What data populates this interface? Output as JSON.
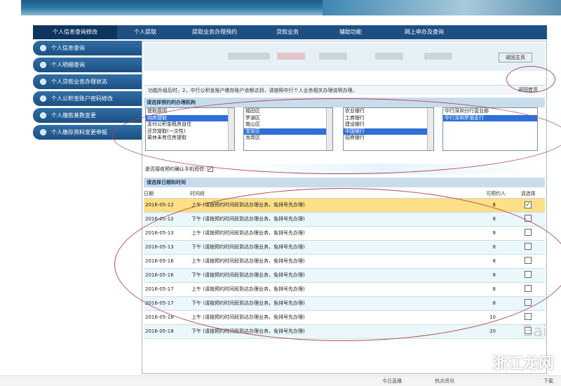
{
  "nav": {
    "tabs": [
      "个人信息查询修改",
      "个人提取",
      "提取业务办理预约",
      "贷款业务",
      "辅助功能",
      "网上申办及查询"
    ]
  },
  "sidebar": {
    "items": [
      "个人信息查询",
      "个人明细查询",
      "个人贷款业务办理状态",
      "个人公积金账户密码修改",
      "个人缴款基数变更",
      "个人缴存资料变更申报"
    ]
  },
  "header": {
    "return_label": "返回主页"
  },
  "notice": {
    "text": "功能升级后时，2，中行公积金账户缴存账户余额达到，请按照中行个人业务相关办理说明办理。",
    "help_label": "返回首页"
  },
  "institution": {
    "section_title": "请选择预约的办理机构",
    "list1": [
      "提取原因",
      "购房提取",
      "支付公积金租房自住",
      "还贷提取(一次性)",
      "离休未有住房提取"
    ],
    "list1_selected": 1,
    "list2": [
      "福田区",
      "罗湖区",
      "南山区",
      "宝安区",
      "龙岗区"
    ],
    "list2_selected": 3,
    "list3": [
      "农业银行",
      "工商银行",
      "建设银行",
      "中国银行",
      "招商银行"
    ],
    "list3_selected": 3,
    "list4": [
      "中行深圳分行营业部",
      "中行深圳罗湖支行"
    ],
    "list4_selected": 1
  },
  "email": {
    "label": "是否接收预约确认手机短信:"
  },
  "slots": {
    "section_title": "请选择日期和时间",
    "headers": [
      "日期",
      "时间段",
      "可预约人",
      "请选择"
    ],
    "rows": [
      {
        "date": "2016-05-12",
        "period": "上午 (请按预约时间段到达办理业务，免排号先办理)",
        "count": "8",
        "checked": true
      },
      {
        "date": "2016-05-12",
        "period": "下午 (请按预约时间段到达办理业务，免排号先办理)",
        "count": "8",
        "checked": false
      },
      {
        "date": "2016-05-13",
        "period": "上午 (请按预约时间段到达办理业务，免排号先办理)",
        "count": "8",
        "checked": false
      },
      {
        "date": "2016-05-13",
        "period": "下午 (请按预约时间段到达办理业务，免排号先办理)",
        "count": "8",
        "checked": false
      },
      {
        "date": "2016-05-16",
        "period": "上午 (请按预约时间段到达办理业务，免排号先办理)",
        "count": "8",
        "checked": false
      },
      {
        "date": "2016-05-16",
        "period": "下午 (请按预约时间段到达办理业务，免排号先办理)",
        "count": "8",
        "checked": false
      },
      {
        "date": "2016-05-17",
        "period": "上午 (请按预约时间段到达办理业务，免排号先办理)",
        "count": "8",
        "checked": false
      },
      {
        "date": "2016-05-17",
        "period": "下午 (请按预约时间段到达办理业务，免排号先办理)",
        "count": "8",
        "checked": false
      },
      {
        "date": "2016-05-18",
        "period": "上午 (请按预约时间段到达办理业务，免排号先办理)",
        "count": "10",
        "checked": false
      },
      {
        "date": "2016-05-18",
        "period": "下午 (请按预约时间段到达办理业务，免排号先办理)",
        "count": "20",
        "checked": false
      }
    ]
  },
  "watermark": {
    "site": "浙江龙网",
    "baidu": "Bai"
  },
  "statusbar": {
    "today": "今日直播",
    "speed": "热点资讯",
    "download": "下载"
  }
}
